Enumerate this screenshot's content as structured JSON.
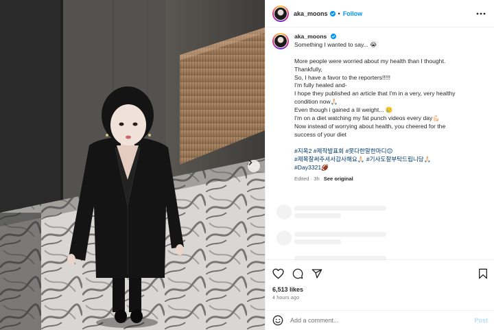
{
  "header": {
    "username": "aka_moons",
    "separator": "•",
    "follow_label": "Follow"
  },
  "caption": {
    "username": "aka_moons",
    "lines": [
      "Something I wanted to say... 😭",
      "",
      "More people were worried about my health than I thought.",
      "Thankfully,",
      "So, I have a favor to the reporters!!!!!",
      "I'm fully healed and-",
      "I hope they published an article that I'm in a very, very healthy",
      "condition now🙏🏻",
      "Even though i gained a lil weight... 🥲",
      "I'm on a diet watching my fat punch videos every day💪🏻",
      "Now instead of worrying about health, you cheered for the",
      "success of your diet",
      ""
    ],
    "hashtags": [
      "#지옥2 #제작발표회 #못다한말한마디😊",
      "#제목잘써주셔서감사해요🙏🏻 #기사도잘부탁드립니당🙏🏻",
      "#Day3321🏈"
    ],
    "edited": "Edited · 3h",
    "see_original": "See original"
  },
  "engagement": {
    "likes": "6,513 likes",
    "time_ago": "4 hours ago"
  },
  "comment_box": {
    "placeholder": "Add a comment...",
    "post_label": "Post"
  },
  "icons": {
    "more": "more-icon",
    "like": "heart-icon",
    "comment": "comment-icon",
    "share": "share-icon",
    "save": "bookmark-icon",
    "emoji": "emoji-icon",
    "next": "chevron-right-icon",
    "verified": "verified-badge-icon"
  },
  "colors": {
    "accent": "#0095f6",
    "link": "#00376b",
    "muted": "#737373",
    "post_disabled": "#b2dffc"
  }
}
